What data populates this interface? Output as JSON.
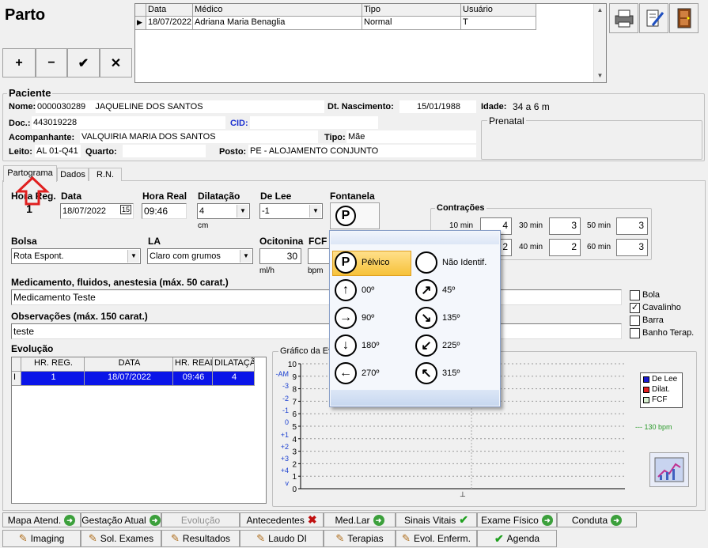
{
  "app": {
    "title": "Parto"
  },
  "toolbar": {
    "add": "+",
    "remove": "−",
    "confirm": "✔",
    "cancel": "✕"
  },
  "records": {
    "headers": [
      "Data",
      "Médico",
      "Tipo",
      "Usuário"
    ],
    "row": {
      "marker": "▶",
      "data": "18/07/2022",
      "medico": "Adriana Maria Benaglia",
      "tipo": "Normal",
      "usuario": "T"
    }
  },
  "patient": {
    "section": "Paciente",
    "nome_label": "Nome:",
    "nome_id": "0000030289",
    "nome": "JAQUELINE DOS SANTOS",
    "nasc_label": "Dt. Nascimento:",
    "nasc": "15/01/1988",
    "idade_label": "Idade:",
    "idade": "34 a 6 m",
    "doc_label": "Doc.:",
    "doc": "443019228",
    "cid_label": "CID:",
    "acomp_label": "Acompanhante:",
    "acomp": "VALQUIRIA MARIA DOS SANTOS",
    "tipo_label": "Tipo:",
    "tipo": "Mãe",
    "leito_label": "Leito:",
    "leito": "AL 01-Q41",
    "quarto_label": "Quarto:",
    "posto_label": "Posto:",
    "posto": "PE - ALOJAMENTO CONJUNTO",
    "prenatal": "Prenatal"
  },
  "tabs": [
    "Partograma",
    "Dados",
    "R.N."
  ],
  "form": {
    "hora_reg_label": "Hora Reg.",
    "hora_reg": "1",
    "data_label": "Data",
    "data": "18/07/2022",
    "cal_icon": "15",
    "hora_real_label": "Hora Real",
    "hora_real": "09:46",
    "dilatacao_label": "Dilatação",
    "dilatacao": "4",
    "dilatacao_unit": "cm",
    "delee_label": "De Lee",
    "delee": "-1",
    "fontanela_label": "Fontanela",
    "fontanela_value": "P",
    "contracoes_label": "Contrações",
    "c10_label": "10 min",
    "c10": "4",
    "c20": "2",
    "c30_label": "30 min",
    "c30": "3",
    "c40_label": "40 min",
    "c40": "2",
    "c50_label": "50 min",
    "c50": "3",
    "c60_label": "60 min",
    "c60": "3",
    "bolsa_label": "Bolsa",
    "bolsa": "Rota Espont.",
    "la_label": "LA",
    "la": "Claro com grumos",
    "ocitonina_label": "Ocitonina",
    "ocitonina": "30",
    "ocitonina_unit": "ml/h",
    "fcf_label": "FCF",
    "fcf_unit": "bpm",
    "med_label": "Medicamento, fluidos, anestesia (máx. 50 carat.)",
    "med": "Medicamento Teste",
    "obs_label": "Observações (máx. 150 carat.)",
    "obs": "teste",
    "checks": [
      {
        "label": "Bola",
        "checked": false
      },
      {
        "label": "Cavalinho",
        "checked": true
      },
      {
        "label": "Barra",
        "checked": false
      },
      {
        "label": "Banho Terap.",
        "checked": false
      }
    ]
  },
  "fontanela_menu": [
    {
      "icon": "P",
      "label": "Pélvico"
    },
    {
      "icon": "",
      "label": "Não Identif."
    },
    {
      "icon": "↑",
      "label": "00º"
    },
    {
      "icon": "↗",
      "label": "45º"
    },
    {
      "icon": "→",
      "label": "90º"
    },
    {
      "icon": "↘",
      "label": "135º"
    },
    {
      "icon": "↓",
      "label": "180º"
    },
    {
      "icon": "↙",
      "label": "225º"
    },
    {
      "icon": "←",
      "label": "270º"
    },
    {
      "icon": "↖",
      "label": "315º"
    }
  ],
  "evolucao": {
    "label": "Evolução",
    "headers": [
      "HR. REG.",
      "DATA",
      "HR. REAL",
      "DILATAÇÃO"
    ],
    "row": {
      "marker": "I",
      "hr_reg": "1",
      "data": "18/07/2022",
      "hr_real": "09:46",
      "dilatacao": "4"
    }
  },
  "graph": {
    "title": "Gráfico da Ev",
    "left_labels": [
      "-AM",
      "-3",
      "-2",
      "-1",
      "0",
      "+1",
      "+2",
      "+3",
      "+4",
      "v"
    ],
    "legend": [
      {
        "label": "De Lee",
        "color": "#1a1ad0"
      },
      {
        "label": "Dilat.",
        "color": "#e02020"
      },
      {
        "label": "FCF",
        "color": "#d8f0d0"
      }
    ],
    "fcf_ref": "--- 130 bpm"
  },
  "buttons_row1": [
    {
      "label": "Mapa Atend.",
      "icon": "go"
    },
    {
      "label": "Gestação Atual",
      "icon": "go"
    },
    {
      "label": "Evolução",
      "icon": "",
      "disabled": true
    },
    {
      "label": "Antecedentes",
      "icon": "x"
    },
    {
      "label": "Med.Lar",
      "icon": "go"
    },
    {
      "label": "Sinais Vitais",
      "icon": "check"
    },
    {
      "label": "Exame Físico",
      "icon": "go"
    },
    {
      "label": "Conduta",
      "icon": "go"
    }
  ],
  "buttons_row2": [
    {
      "label": "Imaging"
    },
    {
      "label": "Sol. Exames"
    },
    {
      "label": "Resultados"
    },
    {
      "label": "Laudo DI"
    },
    {
      "label": "Terapias"
    },
    {
      "label": "Evol. Enferm."
    },
    {
      "label": "Agenda",
      "icon": "check"
    }
  ]
}
